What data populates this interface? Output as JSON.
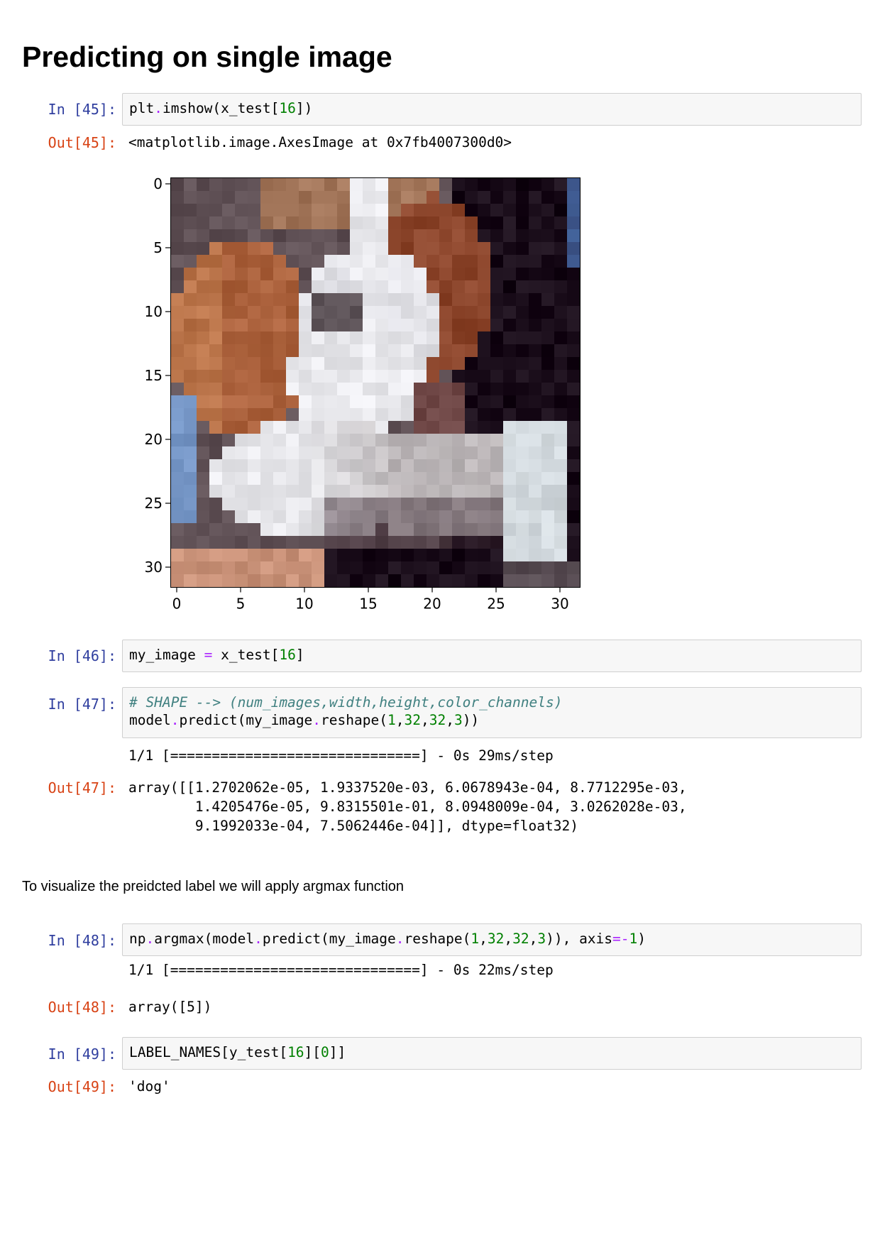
{
  "heading": "Predicting on single image",
  "cells": {
    "c45": {
      "in_prompt": "In [45]:",
      "out_prompt": "Out[45]:",
      "out_text": "<matplotlib.image.AxesImage at 0x7fb4007300d0>"
    },
    "c46": {
      "in_prompt": "In [46]:"
    },
    "c47": {
      "in_prompt": "In [47]:",
      "comment": "# SHAPE --> (num_images,width,height,color_channels)",
      "stream": "1/1 [==============================] - 0s 29ms/step",
      "out_prompt": "Out[47]:",
      "out_text": "array([[1.2702062e-05, 1.9337520e-03, 6.0678943e-04, 8.7712295e-03,\n        1.4205476e-05, 9.8315501e-01, 8.0948009e-04, 3.0262028e-03,\n        9.1992033e-04, 7.5062446e-04]], dtype=float32)"
    },
    "markdown": "To visualize the preidcted label we will apply argmax function",
    "c48": {
      "in_prompt": "In [48]:",
      "stream": "1/1 [==============================] - 0s 22ms/step",
      "out_prompt": "Out[48]:",
      "out_text": "array([5])"
    },
    "c49": {
      "in_prompt": "In [49]:",
      "out_prompt": "Out[49]:",
      "out_text": "'dog'"
    }
  },
  "plot": {
    "y_ticks": [
      "0",
      "5",
      "10",
      "15",
      "20",
      "25",
      "30"
    ],
    "x_ticks": [
      "0",
      "5",
      "10",
      "15",
      "20",
      "25",
      "30"
    ]
  }
}
